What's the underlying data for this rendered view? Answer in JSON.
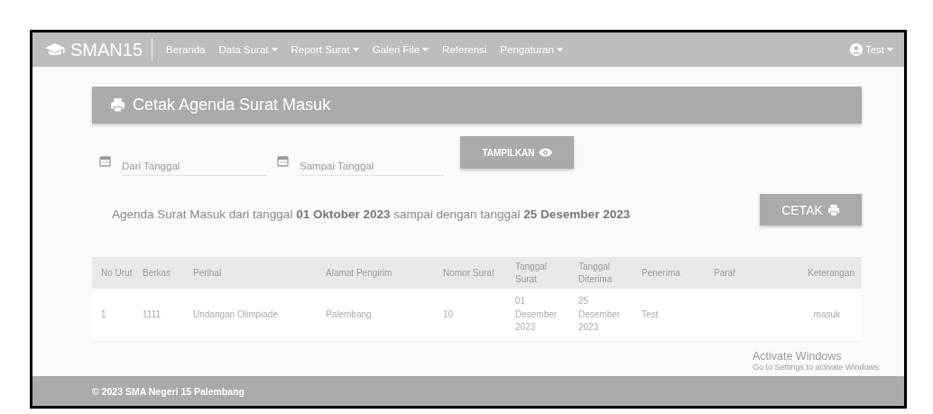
{
  "navbar": {
    "brand": "SMAN15",
    "items": [
      {
        "label": "Beranda",
        "dropdown": false
      },
      {
        "label": "Data Surat",
        "dropdown": true
      },
      {
        "label": "Report Surat",
        "dropdown": true
      },
      {
        "label": "Galeri File",
        "dropdown": true
      },
      {
        "label": "Referensi",
        "dropdown": false
      },
      {
        "label": "Pengaturan",
        "dropdown": true
      }
    ],
    "user": {
      "label": "Test",
      "dropdown": true
    }
  },
  "title": "Cetak Agenda Surat Masuk",
  "filters": [
    {
      "placeholder": "Dari Tanggal"
    },
    {
      "placeholder": "Sampai Tanggal"
    }
  ],
  "show_button": "TAMPILKAN",
  "summary": "Agenda Surat Masuk dari tanggal **01 Oktober 2023** sampai dengan tanggal **25 Desember 2023**",
  "print_button": "CETAK",
  "table": {
    "columns": [
      "No Urut",
      "Berkas",
      "Perihal",
      "Alamat Pengirim",
      "Nomor Surat",
      "Tanggal Surat",
      "Tanggal Diterima",
      "Penerima",
      "Paraf",
      "Keterangan"
    ],
    "rows": [
      [
        "1",
        "1111",
        "Undangan Olimpiade",
        "Palembang",
        "10",
        "01 Desember 2023",
        "25 Desember 2023",
        "Test",
        "",
        "masuk"
      ]
    ]
  },
  "footer": "© 2023 SMA Negeri 15 Palembang",
  "os_notice": {
    "title": "Activate Windows",
    "text": "Go to Settings to activate Windows."
  }
}
